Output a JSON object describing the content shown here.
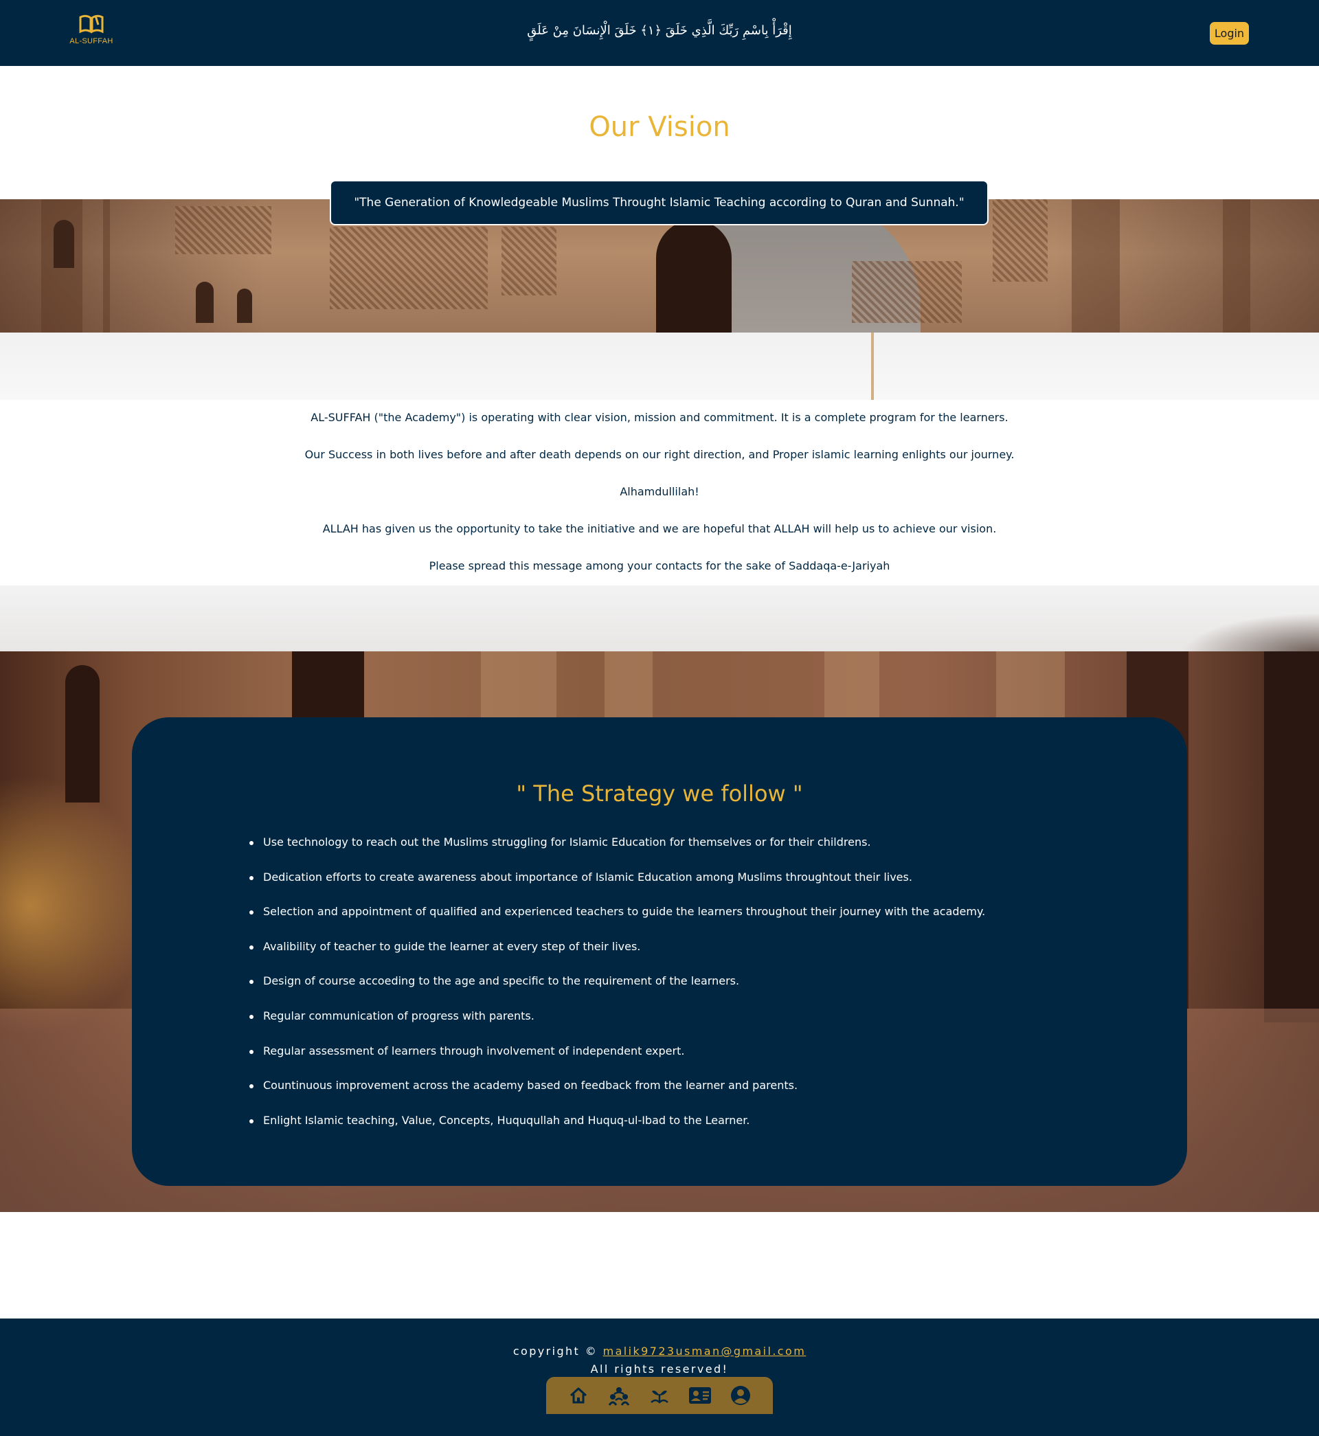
{
  "header": {
    "logo_text": "AL-SUFFAH",
    "verse": "إِقْرَأْ بِاسْمِ رَبِّكَ الَّذِي خَلَقَ ﴿١﴾ خَلَقَ الْإِنسَانَ مِنْ عَلَقٍ",
    "login_label": "Login"
  },
  "vision": {
    "title": "Our Vision",
    "quote": "\"The Generation of Knowledgeable Muslims Throught Islamic Teaching according to Quran and Sunnah.\""
  },
  "about": {
    "paragraphs": [
      "AL-SUFFAH (\"the Academy\") is operating with clear vision, mission and commitment. It is a complete program for the learners.",
      "Our Success in both lives before and after death depends on our right direction, and Proper islamic learning enlights our journey.",
      "Alhamdullilah!",
      "ALLAH has given us the opportunity to take the initiative and we are hopeful that ALLAH will help us to achieve our vision.",
      "Please spread this message among your contacts for the sake of Saddaqa-e-Jariyah"
    ]
  },
  "strategy": {
    "title": "\" The Strategy we follow \"",
    "items": [
      "Use technology to reach out the Muslims struggling for Islamic Education for themselves or for their childrens.",
      "Dedication efforts to create awareness about importance of Islamic Education among Muslims throughtout their lives.",
      "Selection and appointment of qualified and experienced teachers to guide the learners throughout their journey with the academy.",
      "Avalibility of teacher to guide the learner at every step of their lives.",
      "Design of course accoeding to the age and specific to the requirement of the learners.",
      "Regular communication of progress with parents.",
      "Regular assessment of learners through involvement of independent expert.",
      "Countinuous improvement across the academy based on feedback from the learner and parents.",
      "Enlight Islamic teaching, Value, Concepts, Huququllah and Huquq-ul-Ibad to the Learner."
    ]
  },
  "footer": {
    "copyright_prefix": "copyright ©",
    "email": "malik9723usman@gmail.com",
    "rights": "All rights reserved!",
    "nav_icons": [
      "home-icon",
      "people-icon",
      "plant-icon",
      "contact-card-icon",
      "user-circle-icon"
    ]
  },
  "colors": {
    "navy": "#002642",
    "gold": "#e9b538",
    "login_bg": "#f0b93a",
    "nav_bg": "#8a6a2a"
  }
}
